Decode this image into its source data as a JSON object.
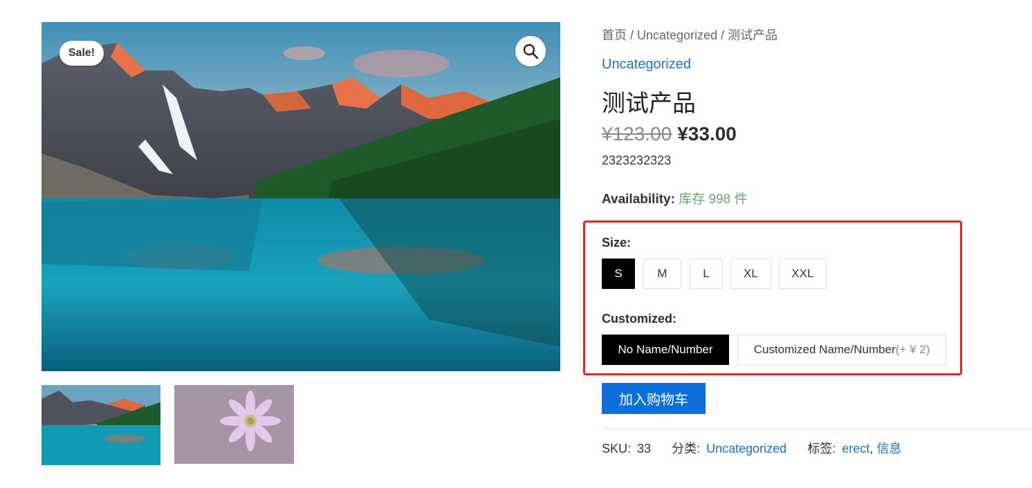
{
  "gallery": {
    "sale_badge": "Sale!",
    "zoom_icon": "search-icon",
    "main_image": "mountain-lake-landscape",
    "thumbnails": [
      "mountain-lake-landscape",
      "pink-daisy-flower"
    ]
  },
  "breadcrumb": {
    "home": "首页",
    "sep": " / ",
    "category": "Uncategorized",
    "current": "测试产品"
  },
  "product": {
    "category": "Uncategorized",
    "title": "测试产品",
    "old_price": "¥123.00",
    "new_price": "¥33.00",
    "short_description": "2323232323",
    "availability_label": "Availability:",
    "availability_value": "库存 998 件"
  },
  "variations": {
    "size_label": "Size:",
    "sizes": [
      "S",
      "M",
      "L",
      "XL",
      "XXL"
    ],
    "selected_size": "S",
    "customized_label": "Customized:",
    "custom_options": [
      {
        "label": "No Name/Number",
        "addon": ""
      },
      {
        "label": "Customized Name/Number",
        "addon": "(+ ¥ 2)"
      }
    ],
    "selected_custom": "No Name/Number"
  },
  "cart": {
    "add_to_cart": "加入购物车"
  },
  "meta": {
    "sku_label": "SKU:",
    "sku_value": "33",
    "category_label": "分类:",
    "category_value": "Uncategorized",
    "tags_label": "标签:",
    "tag1": "erect",
    "tag_sep": ",",
    "tag2": "信息"
  },
  "colors": {
    "accent": "#0d6fd9",
    "link": "#1a6fd1",
    "highlight_border": "#e52620",
    "stock": "#6aa56a"
  }
}
